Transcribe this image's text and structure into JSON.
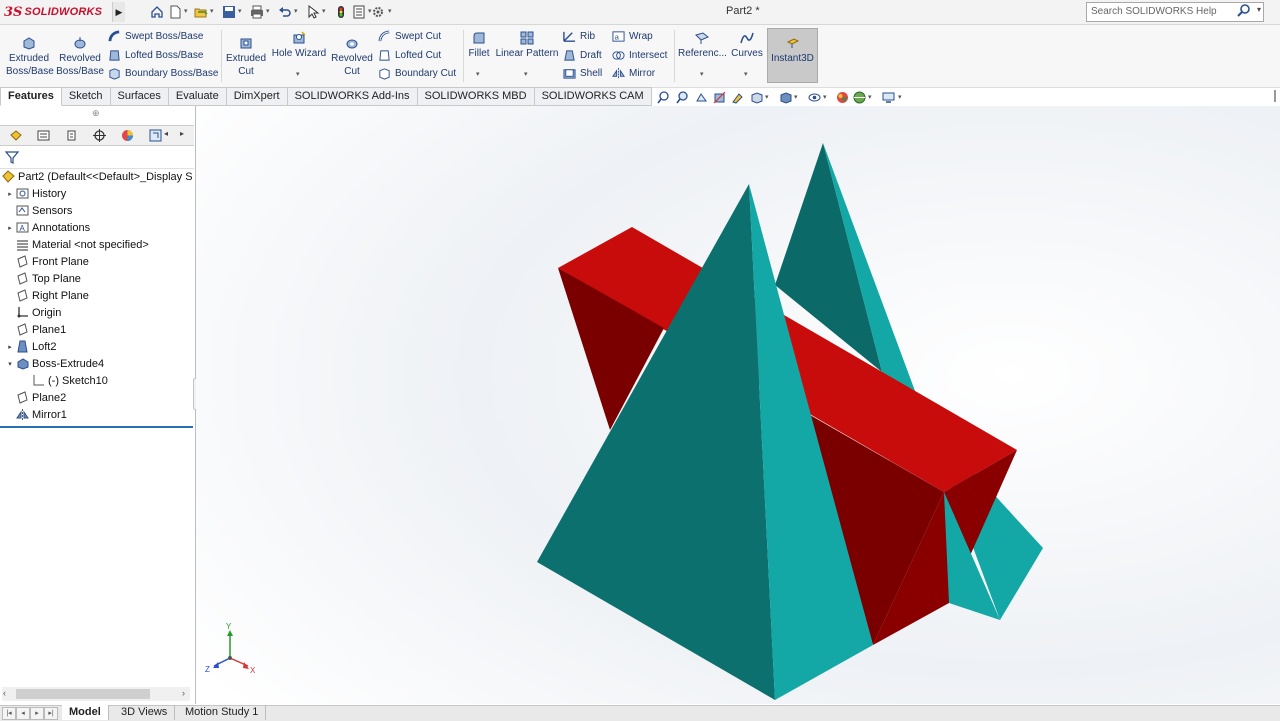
{
  "app": {
    "brand": "SOLIDWORKS",
    "brand_prefix": "3S",
    "document_title": "Part2 *"
  },
  "search": {
    "placeholder": "Search SOLIDWORKS Help"
  },
  "quick_access": [
    "home-icon",
    "new-icon",
    "open-icon",
    "save-icon",
    "print-icon",
    "undo-icon",
    "select-icon",
    "rebuild-icon",
    "file-properties-icon",
    "options-icon"
  ],
  "command_manager": {
    "extruded_boss": "Extruded\nBoss/Base",
    "extruded_boss_l1": "Extruded",
    "extruded_boss_l2": "Boss/Base",
    "revolved_boss_l1": "Revolved",
    "revolved_boss_l2": "Boss/Base",
    "swept_boss": "Swept Boss/Base",
    "lofted_boss": "Lofted Boss/Base",
    "boundary_boss": "Boundary Boss/Base",
    "extruded_cut_l1": "Extruded",
    "extruded_cut_l2": "Cut",
    "hole_wizard": "Hole Wizard",
    "revolved_cut_l1": "Revolved",
    "revolved_cut_l2": "Cut",
    "swept_cut": "Swept Cut",
    "lofted_cut": "Lofted Cut",
    "boundary_cut": "Boundary Cut",
    "fillet": "Fillet",
    "linear_pattern": "Linear Pattern",
    "rib": "Rib",
    "draft": "Draft",
    "shell": "Shell",
    "wrap": "Wrap",
    "intersect": "Intersect",
    "mirror": "Mirror",
    "reference": "Referenc...",
    "curves": "Curves",
    "instant3d": "Instant3D"
  },
  "tabs": [
    "Features",
    "Sketch",
    "Surfaces",
    "Evaluate",
    "DimXpert",
    "SOLIDWORKS Add-Ins",
    "SOLIDWORKS MBD",
    "SOLIDWORKS CAM"
  ],
  "feature_tree": {
    "root": "Part2  (Default<<Default>_Display S",
    "items": [
      {
        "label": "History"
      },
      {
        "label": "Sensors"
      },
      {
        "label": "Annotations"
      },
      {
        "label": "Material <not specified>"
      },
      {
        "label": "Front Plane"
      },
      {
        "label": "Top Plane"
      },
      {
        "label": "Right Plane"
      },
      {
        "label": "Origin"
      },
      {
        "label": "Plane1"
      },
      {
        "label": "Loft2"
      },
      {
        "label": "Boss-Extrude4"
      },
      {
        "label": "(-) Sketch10"
      },
      {
        "label": "Plane2"
      },
      {
        "label": "Mirror1"
      }
    ]
  },
  "triad": {
    "x": "X",
    "y": "Y",
    "z": "Z"
  },
  "bottom_tabs": [
    "Model",
    "3D Views",
    "Motion Study 1"
  ],
  "colors": {
    "teal_light": "#13a8a6",
    "teal_dark": "#0c6e6c",
    "red_light": "#c80c0c",
    "red_dark": "#7a0000",
    "accent_blue": "#2b6fb5"
  }
}
